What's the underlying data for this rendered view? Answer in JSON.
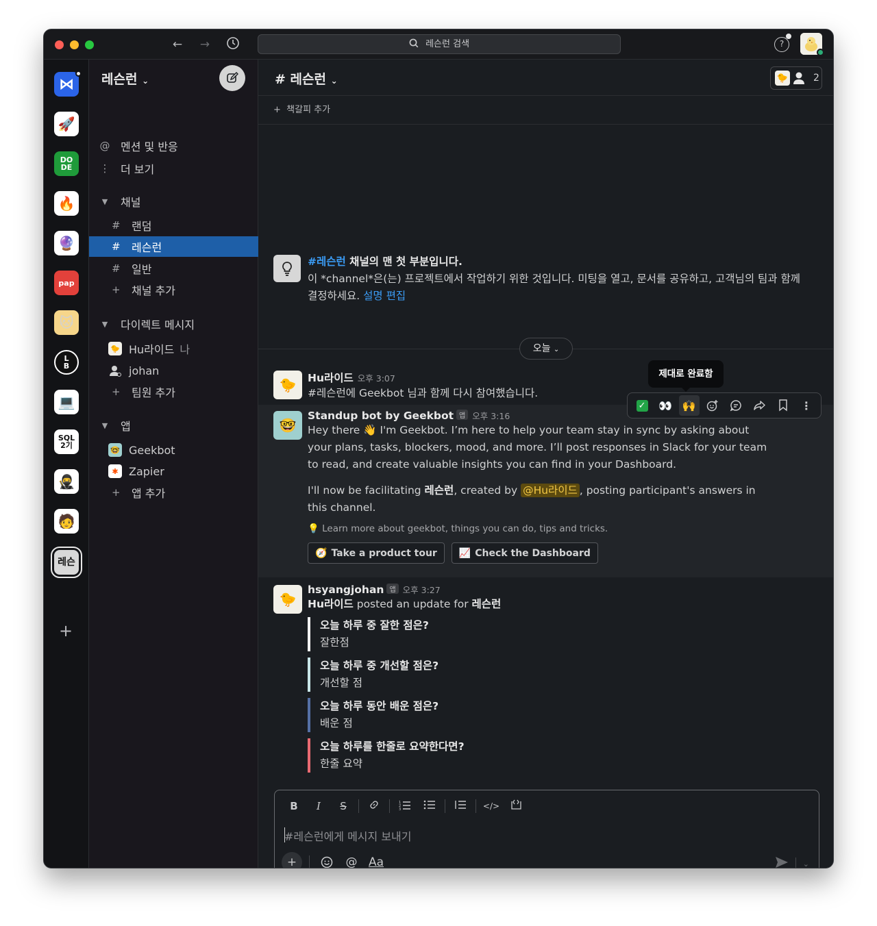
{
  "titlebar": {
    "search_label": "레슨런 검색"
  },
  "rail": {
    "workspaces": [
      {
        "id": "ws-1",
        "label": "",
        "icon": "bow-tie-logo-icon",
        "bg": "#2b64e8"
      },
      {
        "id": "ws-2",
        "label": "",
        "icon": "rocket-icon",
        "bg": "#ffffff"
      },
      {
        "id": "ws-3",
        "label": "DO DE",
        "icon": "dode-logo-icon",
        "bg": "#1f9b3a"
      },
      {
        "id": "ws-4",
        "label": "",
        "icon": "fire-icon",
        "bg": "#ffffff"
      },
      {
        "id": "ws-5",
        "label": "",
        "icon": "crystal-ball-icon",
        "bg": "#ffffff"
      },
      {
        "id": "ws-6",
        "label": "pap",
        "icon": "pap-logo-icon",
        "bg": "#e2413b"
      },
      {
        "id": "ws-7",
        "label": "",
        "icon": "cat-face-icon",
        "bg": "#f6d68a"
      },
      {
        "id": "ws-8",
        "label": "L B",
        "icon": "lb-logo-icon",
        "bg": "#ffffff"
      },
      {
        "id": "ws-9",
        "label": "",
        "icon": "laptop-fire-icon",
        "bg": "#ffffff"
      },
      {
        "id": "ws-10",
        "label": "SQL 2기",
        "icon": "sql-logo-icon",
        "bg": "#ffffff"
      },
      {
        "id": "ws-11",
        "label": "",
        "icon": "character-icon",
        "bg": "#ffffff"
      },
      {
        "id": "ws-12",
        "label": "",
        "icon": "cartoon-icon",
        "bg": "#ffffff"
      },
      {
        "id": "ws-13",
        "label": "레슨",
        "icon": "lessonrun-logo-icon",
        "bg": "#d8d8d8"
      }
    ]
  },
  "sidebar": {
    "workspace_name": "레슨런",
    "top_items": [
      {
        "icon": "@",
        "label": "멘션 및 반응"
      },
      {
        "icon": "⋮",
        "label": "더 보기"
      }
    ],
    "channels_section": "채널",
    "channels": [
      {
        "label": "랜덤",
        "active": false
      },
      {
        "label": "레슨런",
        "active": true
      },
      {
        "label": "일반",
        "active": false
      }
    ],
    "add_channel": "채널 추가",
    "dm_section": "다이렉트 메시지",
    "dms": [
      {
        "label": "Hu라이드",
        "suffix": "나"
      },
      {
        "label": "johan",
        "suffix": ""
      }
    ],
    "add_member": "팀원 추가",
    "apps_section": "앱",
    "apps": [
      {
        "label": "Geekbot"
      },
      {
        "label": "Zapier"
      }
    ],
    "add_app": "앱 추가"
  },
  "channel": {
    "title": "# 레슨런",
    "member_count": "2",
    "bookmark": "책갈피 추가",
    "intro": {
      "channel_link": "#레슨런",
      "heading_rest": " 채널의 맨 첫 부분입니다.",
      "body": "이 *channel*은(는) 프로젝트에서 작업하기 위한 것입니다. 미팅을 열고, 문서를 공유하고, 고객님의 팀과 함께 결정하세요. ",
      "edit_link": "설명 편집"
    },
    "day_label": "오늘"
  },
  "messages": [
    {
      "name": "Hu라이드",
      "time": "오후 3:07",
      "text": "#레슨런에 Geekbot 님과 함께 다시 참여했습니다."
    },
    {
      "name": "Standup bot by Geekbot",
      "badge": "앱",
      "time": "오후 3:16",
      "text1": "Hey there 👋 I'm Geekbot. I’m here to help your team stay in sync by asking about your plans, tasks, blockers, mood, and more. I’ll post responses in Slack for your team to read, and create valuable insights you can find in your Dashboard.",
      "text2_a": "I'll now be facilitating ",
      "text2_b": "레슨런",
      "text2_c": ", created by ",
      "text2_mention": "@Hu라이드",
      "text2_d": ", posting participant's answers in this channel.",
      "tip": "💡 Learn more about geekbot, things you can do, tips and tricks.",
      "buttons": [
        {
          "icon": "🧭",
          "label": "Take a product tour"
        },
        {
          "icon": "📈",
          "label": "Check the Dashboard"
        }
      ]
    },
    {
      "name": "hsyangjohan",
      "badge": "앱",
      "time": "오후 3:27",
      "lead_a": "Hu라이드",
      "lead_b": " posted an update for ",
      "lead_c": "레슨런",
      "qa": [
        {
          "q": "오늘 하루 중 잘한 점은?",
          "a": "잘한점",
          "color": "#f2f2f2"
        },
        {
          "q": "오늘 하루 중 개선할 점은?",
          "a": "개선할 점",
          "color": "#c9e6e8"
        },
        {
          "q": "오늘 하루 동안 배운 점은?",
          "a": "배운 점",
          "color": "#5570a6"
        },
        {
          "q": "오늘 하루를 한줄로 요약한다면?",
          "a": "한줄 요약",
          "color": "#e96a72"
        }
      ]
    }
  ],
  "tooltip": "제대로 완료함",
  "message_actions": [
    "check-mark-icon",
    "eyes-icon",
    "raised-hands-icon",
    "add-reaction-icon",
    "reply-thread-icon",
    "share-icon",
    "bookmark-icon",
    "more-icon"
  ],
  "composer": {
    "placeholder": "#레슨런에게 메시지 보내기",
    "format_icons": [
      "bold-icon",
      "italic-icon",
      "strikethrough-icon",
      "link-icon",
      "ordered-list-icon",
      "bullet-list-icon",
      "blockquote-icon",
      "code-icon",
      "code-block-icon"
    ],
    "text_format_label": "Aa"
  }
}
